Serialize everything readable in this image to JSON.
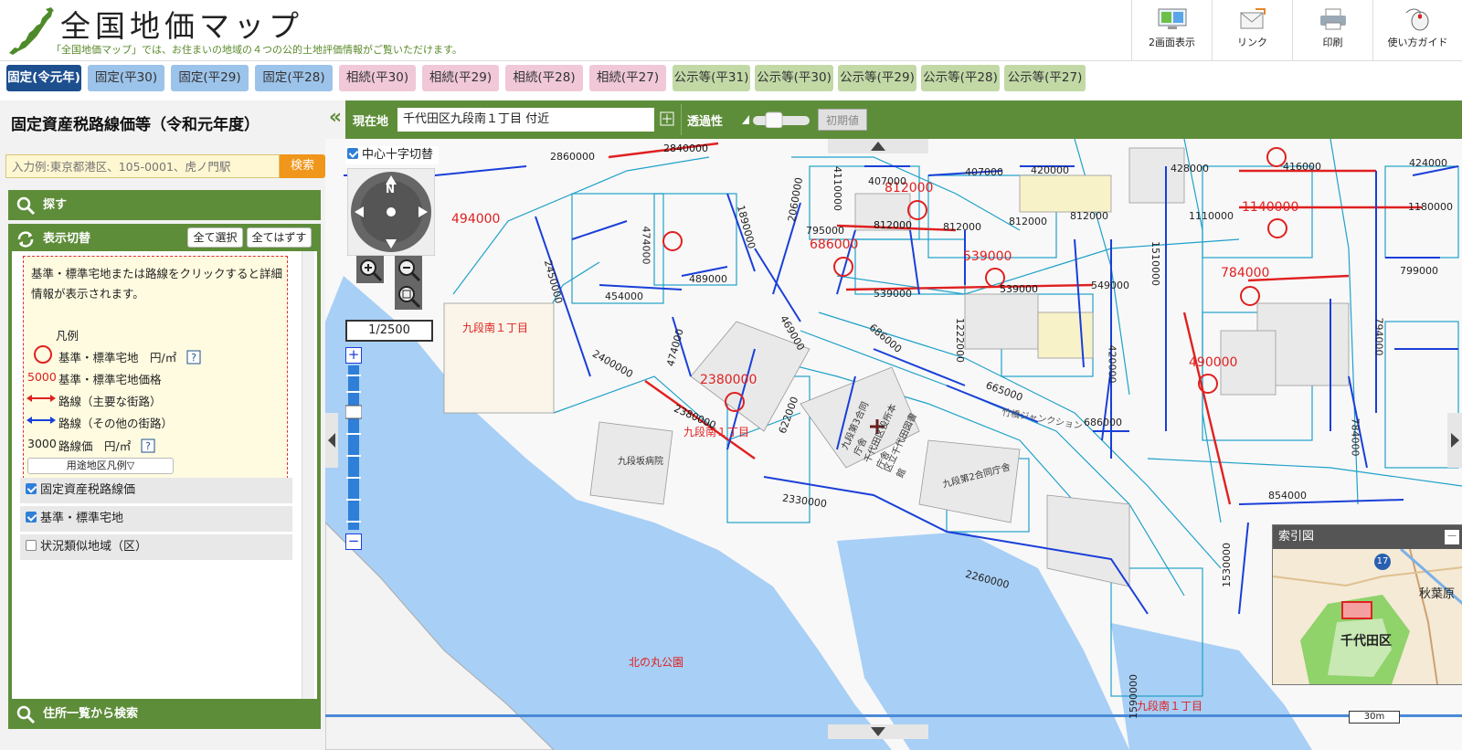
{
  "header": {
    "title": "全国地価マップ",
    "subtitle": "「全国地価マップ」では、お住まいの地域の４つの公的土地評価情報がご覧いただけます。",
    "buttons": [
      {
        "label": "2画面表示",
        "icon": "dual-screen-icon"
      },
      {
        "label": "リンク",
        "icon": "link-mail-icon"
      },
      {
        "label": "印刷",
        "icon": "printer-icon"
      },
      {
        "label": "使い方ガイド",
        "icon": "mouse-guide-icon"
      }
    ]
  },
  "tabs": [
    {
      "label": "固定(令元年)",
      "group": "fix",
      "active": true
    },
    {
      "label": "固定(平30)",
      "group": "fix"
    },
    {
      "label": "固定(平29)",
      "group": "fix"
    },
    {
      "label": "固定(平28)",
      "group": "fix"
    },
    {
      "label": "相続(平30)",
      "group": "inh"
    },
    {
      "label": "相続(平29)",
      "group": "inh"
    },
    {
      "label": "相続(平28)",
      "group": "inh"
    },
    {
      "label": "相続(平27)",
      "group": "inh"
    },
    {
      "label": "公示等(平31)",
      "group": "pub"
    },
    {
      "label": "公示等(平30)",
      "group": "pub"
    },
    {
      "label": "公示等(平29)",
      "group": "pub"
    },
    {
      "label": "公示等(平28)",
      "group": "pub"
    },
    {
      "label": "公示等(平27)",
      "group": "pub"
    }
  ],
  "sidebar": {
    "title": "固定資産税路線価等（令和元年度）",
    "search_placeholder": "入力例:東京都港区、105-0001、虎ノ門駅",
    "search_button": "検索",
    "find_label": "探す",
    "display_label": "表示切替",
    "select_all": "全て選択",
    "deselect_all": "全てはずす",
    "legend": {
      "intro": "基準・標準宅地または路線をクリックすると詳細情報が表示されます。",
      "title": "凡例",
      "item_land": "基準・標準宅地　円/㎡",
      "price_sample": "5000",
      "item_price": "基準・標準宅地価格",
      "item_main_road": "路線（主要な街路）",
      "item_other_road": "路線（その他の街路）",
      "road_price_sample": "3000",
      "item_road_price": "路線価　円/㎡",
      "usage_legend": "用途地区凡例▽"
    },
    "layers": [
      {
        "label": "固定資産税路線価",
        "checked": true
      },
      {
        "label": "基準・標準宅地",
        "checked": true
      },
      {
        "label": "状況類似地域（区）",
        "checked": false
      }
    ],
    "address_search": "住所一覧から検索"
  },
  "toolbar": {
    "collapse": "«",
    "current_label": "現在地",
    "current_value": "千代田区九段南１丁目 付近",
    "opacity_label": "透過性",
    "reset_label": "初期値"
  },
  "map": {
    "crosshair_toggle": "中心十字切替",
    "compass_n": "N",
    "scale": "1/2500",
    "zoom_plus": "+",
    "zoom_minus": "−",
    "scale_bar": "30m",
    "index_title": "索引図",
    "index_minimize": "—",
    "index_labels": {
      "ward": "千代田区",
      "route": "17",
      "station": "秋葉原"
    },
    "areas": [
      {
        "text": "九段南１丁目"
      },
      {
        "text": "九段南１丁目"
      },
      {
        "text": "北の丸公園"
      },
      {
        "text": "九段南１丁目"
      }
    ],
    "land_prices": [
      "812000",
      "494000",
      "686000",
      "539000",
      "2380000",
      "784000",
      "1140000",
      "490000"
    ],
    "road_prices_main": [
      "2840000",
      "812000",
      "539000",
      "2380000"
    ],
    "road_prices_other": [
      "2860000",
      "2450000",
      "474000",
      "454000",
      "489000",
      "1890000",
      "2060000",
      "4110000",
      "407000",
      "407000",
      "420000",
      "795000",
      "812000",
      "812000",
      "812000",
      "549000",
      "539000",
      "469000",
      "686000",
      "622000",
      "2400000",
      "474000",
      "1222000",
      "665000",
      "686000",
      "2330000",
      "2260000",
      "428000",
      "416000",
      "424000",
      "1110000",
      "1180000",
      "799000",
      "794000",
      "1590000",
      "854000",
      "1530000",
      "784000",
      "1510000",
      "420000"
    ],
    "buildings": [
      "九段第3合同庁舎",
      "千代田区役所本庁舎",
      "区立千代田図書館",
      "九段第2合同庁舎",
      "九段坂病院",
      "竹橋ジャンクション"
    ],
    "colors": {
      "main_road": "#e02020",
      "other_road": "#1a3fd8",
      "water": "#a8cff5",
      "block": "#1fa1c9",
      "land": "#e02020"
    }
  }
}
